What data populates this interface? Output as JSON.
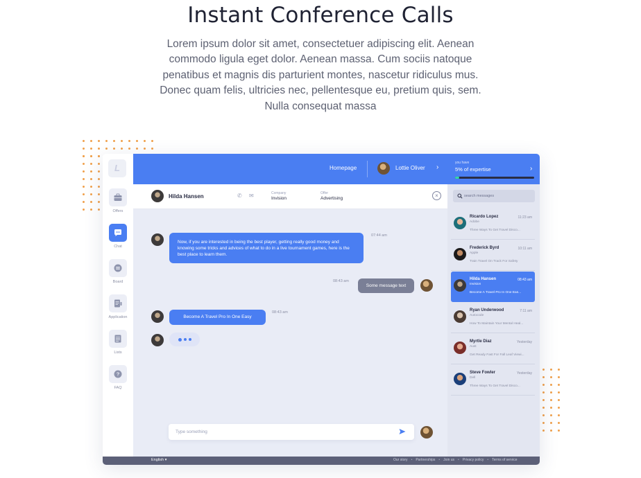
{
  "hero": {
    "title": "Instant Conference Calls",
    "lines": [
      "Lorem ipsum dolor sit amet, consectetuer adipiscing elit. Aenean",
      "commodo ligula eget dolor. Aenean massa. Cum sociis natoque",
      "penatibus et magnis dis parturient montes, nascetur ridiculus mus.",
      "Donec quam felis, ultricies nec, pellentesque eu, pretium quis, sem.",
      "Nulla consequat massa"
    ]
  },
  "nav": {
    "logo": "L",
    "items": [
      {
        "label": "Offers",
        "icon": "briefcase-icon"
      },
      {
        "label": "Chat",
        "icon": "chat-icon"
      },
      {
        "label": "Board",
        "icon": "board-icon"
      },
      {
        "label": "Application",
        "icon": "application-icon"
      },
      {
        "label": "Lists",
        "icon": "list-icon"
      },
      {
        "label": "FAQ",
        "icon": "question-icon"
      }
    ],
    "active": "Chat"
  },
  "topbar": {
    "homepage": "Homepage",
    "user": "Lottie Oliver",
    "chevron": "›"
  },
  "chat_header": {
    "name": "Hilda Hansen",
    "phone_icon": "✆",
    "mail_icon": "✉",
    "company_label": "Company",
    "company_value": "Invision",
    "offer_label": "Offer",
    "offer_value": "Advertising",
    "close": "×"
  },
  "messages": {
    "m1": {
      "text": "Now, if you are interested in being the best player, getting really good money and knowing some tricks and advices of what to do in a live tournament games, here is the best place to learn them.",
      "time": "07:44 am"
    },
    "m2": {
      "text": "Some message text",
      "time": "08:43 am"
    },
    "m3": {
      "text": "Become A Travel Pro In One Easy",
      "time": "08:43 am"
    }
  },
  "composer": {
    "placeholder": "Type something"
  },
  "footer": {
    "language": "English ▾",
    "links": [
      "Our story",
      "Partnerships",
      "Join us",
      "Privacy policy",
      "Terms of service"
    ]
  },
  "sidebar": {
    "small_label": "you have",
    "expertise": "5% of expertise",
    "progress": 0.05,
    "search_placeholder": "search messages",
    "contacts": [
      {
        "name": "Ricardo Lopez",
        "time": "11:23 am",
        "company": "Adobe",
        "preview": "Three Ways To Get Travel Disco..."
      },
      {
        "name": "Frederick Byrd",
        "time": "10:11 am",
        "company": "Apple",
        "preview": "Train Travel On Track For Safety"
      },
      {
        "name": "Hilda Hansen",
        "time": "08:43 am",
        "company": "Invision",
        "preview": "Become A Travel Pro In One Eas..."
      },
      {
        "name": "Ryan Underwood",
        "time": "7:11 am",
        "company": "Autocode",
        "preview": "How To Maintain Your Mental Heal..."
      },
      {
        "name": "Myrtle Diaz",
        "time": "Yesterday",
        "company": "Aust",
        "preview": "Get Ready Fast For Fall Leaf Viewi..."
      },
      {
        "name": "Steve Fowler",
        "time": "Yesterday",
        "company": "Dell",
        "preview": "Three Ways To Get Travel Disco..."
      }
    ]
  },
  "colors": {
    "accent": "#4a7ef2",
    "progress": "#36d6a3",
    "dots": "#f0a04b"
  }
}
